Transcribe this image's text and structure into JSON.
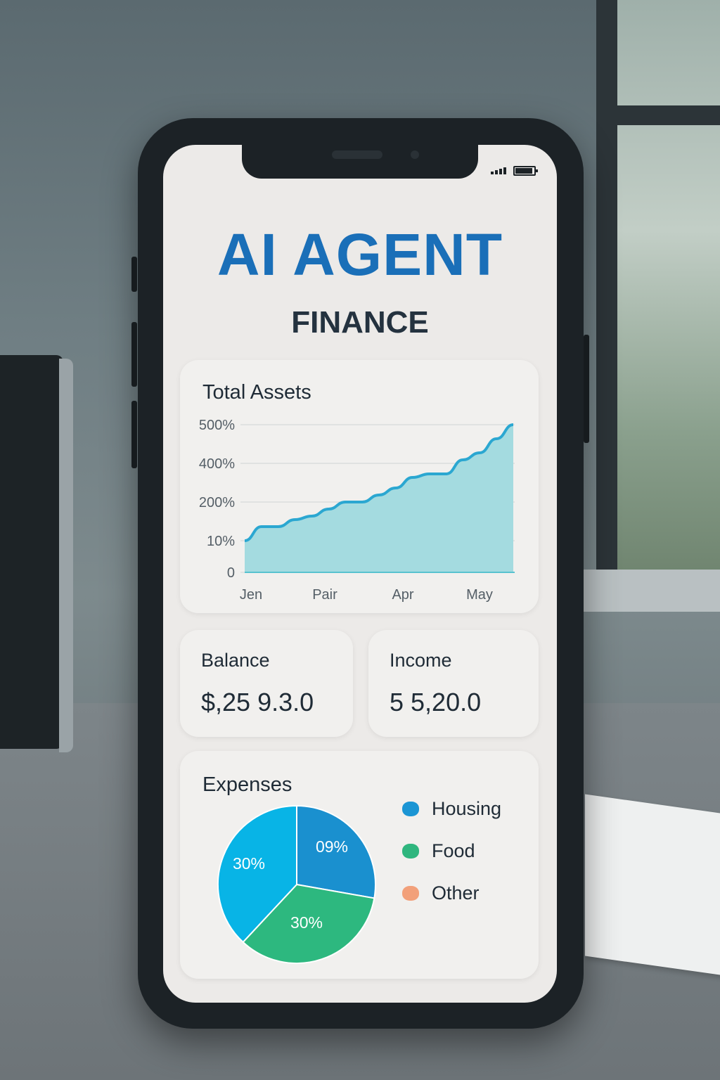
{
  "app": {
    "title": "AI AGENT",
    "subtitle": "FINANCE"
  },
  "total_assets": {
    "title": "Total Assets",
    "y_tick_labels": [
      "500%",
      "400%",
      "200%",
      "10%",
      "0"
    ],
    "x_tick_labels": [
      "Jen",
      "Pair",
      "Apr",
      "May"
    ]
  },
  "balance": {
    "label": "Balance",
    "value": "$,25 9.3.0"
  },
  "income": {
    "label": "Income",
    "value": "5 5,20.0"
  },
  "expenses": {
    "title": "Expenses",
    "legend": [
      {
        "label": "Housing",
        "color": "#1b95d4"
      },
      {
        "label": "Food",
        "color": "#2fb67e"
      },
      {
        "label": "Other",
        "color": "#f2a07a"
      }
    ],
    "slices": [
      {
        "label": "09%",
        "color": "#1a90cf"
      },
      {
        "label": "30%",
        "color": "#2db87f"
      },
      {
        "label": "30%",
        "color": "#08b4e6"
      }
    ]
  },
  "chart_data": [
    {
      "type": "area",
      "title": "Total Assets",
      "x_tick_labels": [
        "Jen",
        "Pair",
        "Apr",
        "May"
      ],
      "y_tick_labels": [
        "500%",
        "400%",
        "200%",
        "10%",
        "0"
      ],
      "series": [
        {
          "values": [
            0.9,
            1.3,
            1.3,
            1.5,
            1.6,
            1.8,
            2.0,
            2.0,
            2.2,
            2.4,
            2.7,
            2.8,
            2.8,
            3.2,
            3.4,
            3.8,
            4.2
          ]
        }
      ],
      "grid": true,
      "color": "#a4dbe0",
      "line_color": "#2ba7d1"
    },
    {
      "type": "pie",
      "title": "Expenses",
      "slices": [
        {
          "label": "09%",
          "color": "#1a90cf"
        },
        {
          "label": "30%",
          "color": "#2db87f"
        },
        {
          "label": "30%",
          "color": "#08b4e6"
        }
      ],
      "legend": [
        "Housing",
        "Food",
        "Other"
      ],
      "legend_position": "right"
    }
  ]
}
